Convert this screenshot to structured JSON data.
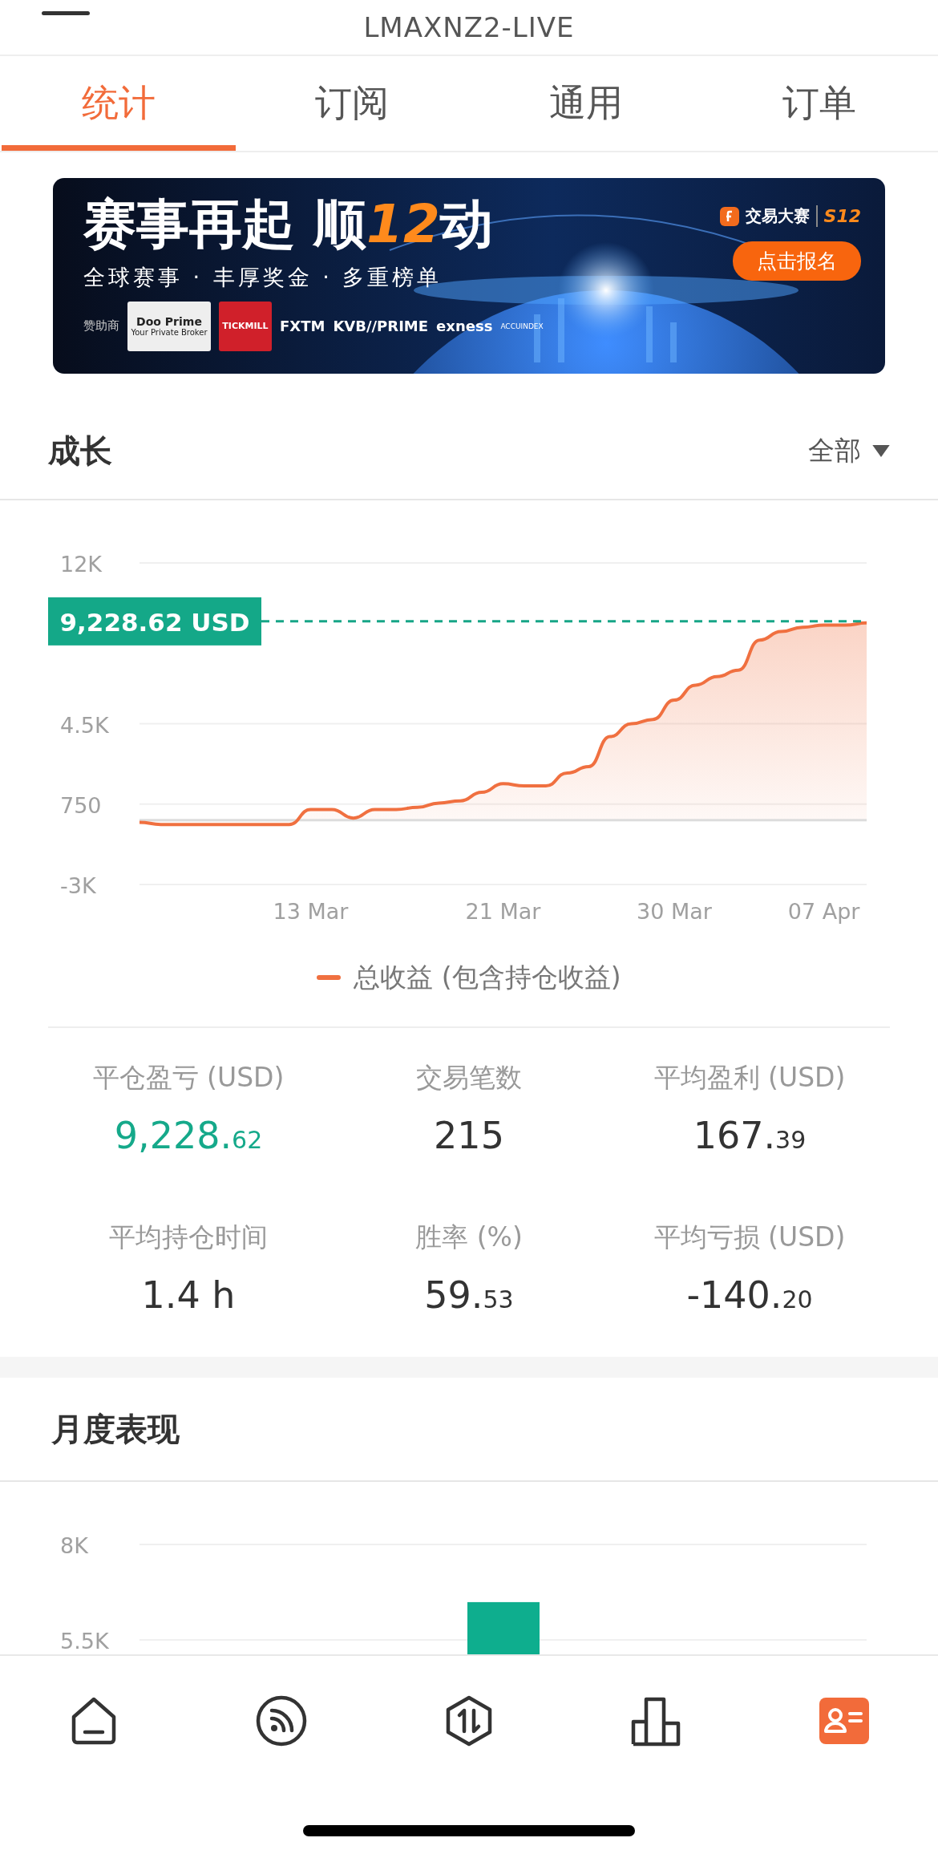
{
  "header": {
    "title": "LMAXNZ2-LIVE"
  },
  "tabs": [
    {
      "label": "统计",
      "selected": true
    },
    {
      "label": "订阅",
      "selected": false
    },
    {
      "label": "通用",
      "selected": false
    },
    {
      "label": "订单",
      "selected": false
    }
  ],
  "banner": {
    "kind": "picture",
    "headline": {
      "text": "赛事再起 顺",
      "accent": "12",
      "suffix": "动"
    },
    "subtitle": "全球赛事 · 丰厚奖金 · 多重榜单",
    "brand": "交易大赛",
    "season": "S12",
    "button": "点击报名",
    "sponsor_label": "赞助商",
    "sponsors": [
      {
        "name": "Doo Prime",
        "tagline": "Your Private Broker",
        "kind": "tile-light"
      },
      {
        "name": "TICKMILL",
        "kind": "tile-red"
      },
      {
        "name": "FXTM",
        "kind": "plain"
      },
      {
        "name": "KVB//PRIME",
        "kind": "plain"
      },
      {
        "name": "exness",
        "kind": "plain"
      },
      {
        "name": "ACCUINDEX",
        "kind": "small"
      }
    ]
  },
  "growth": {
    "title": "成长",
    "filter": "全部",
    "marker": "9,228.62 USD",
    "chart_data": {
      "type": "area",
      "ylim": [
        -3000,
        12000
      ],
      "yticks": [
        {
          "value": -3000,
          "label": "-3K"
        },
        {
          "value": 750,
          "label": "750"
        },
        {
          "value": 4500,
          "label": "4.5K"
        },
        {
          "value": 12000,
          "label": "12K"
        }
      ],
      "categories": [
        null,
        null,
        null,
        null,
        null,
        null,
        null,
        null,
        "13 Mar",
        null,
        null,
        null,
        null,
        null,
        null,
        null,
        null,
        "21 Mar",
        null,
        null,
        null,
        null,
        null,
        null,
        null,
        "30 Mar",
        null,
        null,
        null,
        null,
        null,
        null,
        "07 Apr",
        null,
        null
      ],
      "series": [
        {
          "name": "总收益 (包含持仓收益)",
          "color": "#f07040",
          "values": [
            -100,
            -200,
            -200,
            -200,
            -200,
            -200,
            -200,
            -200,
            500,
            500,
            100,
            500,
            500,
            600,
            800,
            900,
            1300,
            1700,
            1600,
            1600,
            2200,
            2500,
            3900,
            4500,
            4700,
            5600,
            6300,
            6700,
            7000,
            8400,
            8800,
            9000,
            9100,
            9100,
            9200
          ]
        }
      ]
    }
  },
  "stats": [
    {
      "label": "平仓盈亏 (USD)",
      "value": "9,228.62",
      "highlighted": true
    },
    {
      "label": "交易笔数",
      "value": "215",
      "highlighted": false
    },
    {
      "label": "平均盈利 (USD)",
      "value": "167.39",
      "highlighted": false
    },
    {
      "label": "平均持仓时间",
      "value": "1.4 h",
      "highlighted": false
    },
    {
      "label": "胜率 (%)",
      "value": "59.53",
      "highlighted": false
    },
    {
      "label": "平均亏损 (USD)",
      "value": "-140.20",
      "highlighted": false
    }
  ],
  "monthly": {
    "title": "月度表现",
    "chart_data": {
      "type": "bar",
      "ylim": [
        5060,
        8000
      ],
      "yticks": [
        {
          "value": 5500,
          "label": "5.5K"
        },
        {
          "value": 8000,
          "label": "8K"
        }
      ],
      "values": [
        6490
      ]
    }
  },
  "nav": [
    {
      "kind": "home",
      "selected": false
    },
    {
      "kind": "feed",
      "selected": false
    },
    {
      "kind": "trade",
      "selected": false
    },
    {
      "kind": "stats",
      "selected": false
    },
    {
      "kind": "profile",
      "selected": true
    }
  ]
}
